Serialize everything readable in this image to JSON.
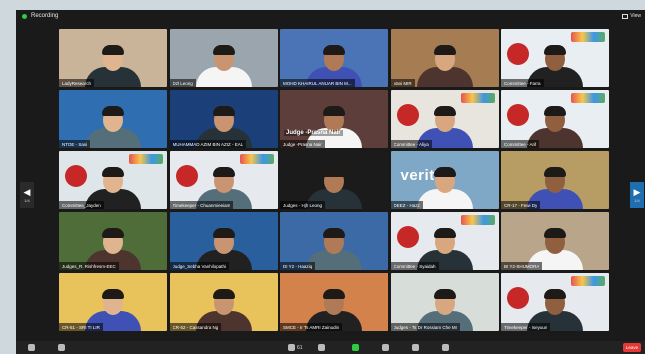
{
  "window": {
    "recording_label": "Recording",
    "view_label": "View",
    "left_page": "1/4",
    "right_page": "1/4"
  },
  "colors": {
    "recording_dot": "#2ecc40",
    "leave_button": "#e53935",
    "active_speaker_border": "#f7d046",
    "app_background": "#1a1a1a"
  },
  "participants": [
    {
      "name": "LadyResearch",
      "bg": "#c9b49a"
    },
    {
      "name": "Dzl Leong",
      "bg": "#9aa5ae"
    },
    {
      "name": "MOHD KHAIRUL ANUAR BIN M...",
      "bg": "#4a74b6"
    },
    {
      "name": "Vani MIR",
      "bg": "#a67c52"
    },
    {
      "name": "Committee - Farra",
      "bg": "#e9eef2",
      "logo": true
    },
    {
      "name": "NTOE - Sasi",
      "bg": "#2f6fb1"
    },
    {
      "name": "MUHAMMAD AZIM BIN AZIZ - EAL",
      "bg": "#1b3f78"
    },
    {
      "name": "Judge -Prasna Nair",
      "bg": "#5e3e3a",
      "overlay": "Judge -Prasna Nair"
    },
    {
      "name": "Committee - Aliya",
      "bg": "#e8e4de",
      "logo": true
    },
    {
      "name": "Committee - Arif",
      "bg": "#e9eef2",
      "logo": true
    },
    {
      "name": "Committee_Jayden",
      "bg": "#dfe6ea",
      "logo": true
    },
    {
      "name": "Timekeeper - Chuanmieeiam",
      "bg": "#e6eaee",
      "logo": true
    },
    {
      "name": "Judges - Hjh Leong",
      "bg": "#1b1b1b"
    },
    {
      "name": "DEEZ - Hazz",
      "bg": "#7fa8c6",
      "bigtext": "veritix"
    },
    {
      "name": "CR-17 - Fewi Dy",
      "bg": "#b79c64"
    },
    {
      "name": "Judges_R. Rishfresm-EEC",
      "bg": "#4e6d38"
    },
    {
      "name": "Judge_Sebha Vanhilopathi",
      "bg": "#2a5f9e"
    },
    {
      "name": "DI Y2 - Haaziq",
      "bg": "#3b6aa6"
    },
    {
      "name": "Committee - Syaidah",
      "bg": "#e6eaee",
      "logo": true
    },
    {
      "name": "BI Y2-SHUMORA",
      "bg": "#b9a58a"
    },
    {
      "name": "CR-51 - SRI TI LIR",
      "bg": "#e8c25b"
    },
    {
      "name": "CR-52 - Cassandra Ng",
      "bg": "#e8c25b"
    },
    {
      "name": "SMCE - Ir Ts AMRI Zainudin",
      "bg": "#d2824a",
      "speaker": true
    },
    {
      "name": "Judges - Ts Dr Rossiam Che Mr",
      "bg": "#d7ddd8"
    },
    {
      "name": "Timekeeper - Iseyuun",
      "bg": "#e6eaee",
      "logo": true
    }
  ],
  "controls": [
    {
      "name": "mic",
      "label": "Unmute"
    },
    {
      "name": "video",
      "label": "Start Video"
    },
    {
      "name": "participants",
      "label": "61"
    },
    {
      "name": "chat",
      "label": "Chat"
    },
    {
      "name": "share",
      "label": "Share"
    },
    {
      "name": "record",
      "label": "Record"
    },
    {
      "name": "reactions",
      "label": "Reactions"
    },
    {
      "name": "apps",
      "label": "Apps"
    }
  ],
  "leave_label": "Leave"
}
